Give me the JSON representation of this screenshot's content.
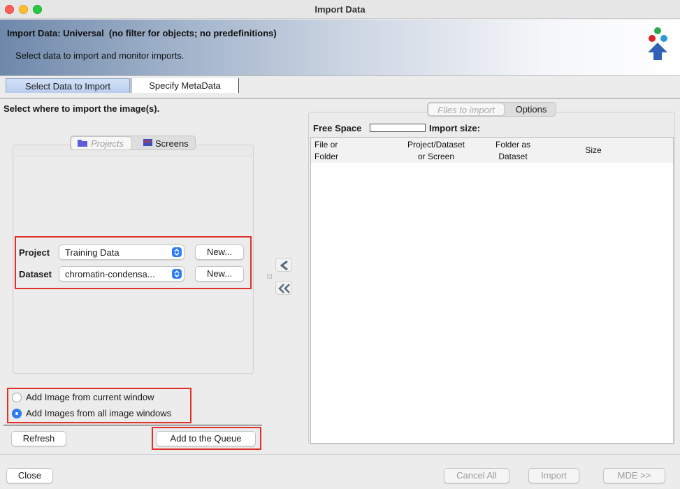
{
  "window": {
    "title": "Import Data"
  },
  "banner": {
    "title": "Import Data: Universal  (no filter for objects; no predefinitions)",
    "subtitle": "Select data to import and monitor imports."
  },
  "tabs": [
    {
      "label": "Select Data to Import",
      "active": true
    },
    {
      "label": "Specify MetaData",
      "active": false
    }
  ],
  "left": {
    "section_label": "Select where to import the image(s).",
    "container_tabs": [
      {
        "label": "Projects",
        "icon": "folder-icon",
        "selected": true
      },
      {
        "label": "Screens",
        "icon": "screen-icon",
        "selected": false
      }
    ],
    "project": {
      "label": "Project",
      "value": "Training Data",
      "new_label": "New..."
    },
    "dataset": {
      "label": "Dataset",
      "value": "chromatin-condensa...",
      "new_label": "New..."
    },
    "options": [
      {
        "label": "Add Image from current window",
        "checked": false
      },
      {
        "label": "Add Images from all image windows",
        "checked": true
      }
    ],
    "refresh_label": "Refresh",
    "add_queue_label": "Add to the Queue"
  },
  "right": {
    "tabs": [
      {
        "label": "Files to import",
        "selected": true
      },
      {
        "label": "Options",
        "selected": false
      }
    ],
    "free_space_label": "Free Space",
    "import_size_label": "Import size:",
    "columns": [
      {
        "line1": "File or",
        "line2": "Folder"
      },
      {
        "line1": "Project/Dataset",
        "line2": "or Screen"
      },
      {
        "line1": "Folder as",
        "line2": "Dataset"
      },
      {
        "line1": "Size",
        "line2": ""
      }
    ]
  },
  "footer": {
    "close_label": "Close",
    "cancel_all_label": "Cancel All",
    "import_label": "Import",
    "mde_label": "MDE >>"
  },
  "colors": {
    "highlight_red": "#e0302a",
    "accent_blue": "#2f7cf6"
  }
}
